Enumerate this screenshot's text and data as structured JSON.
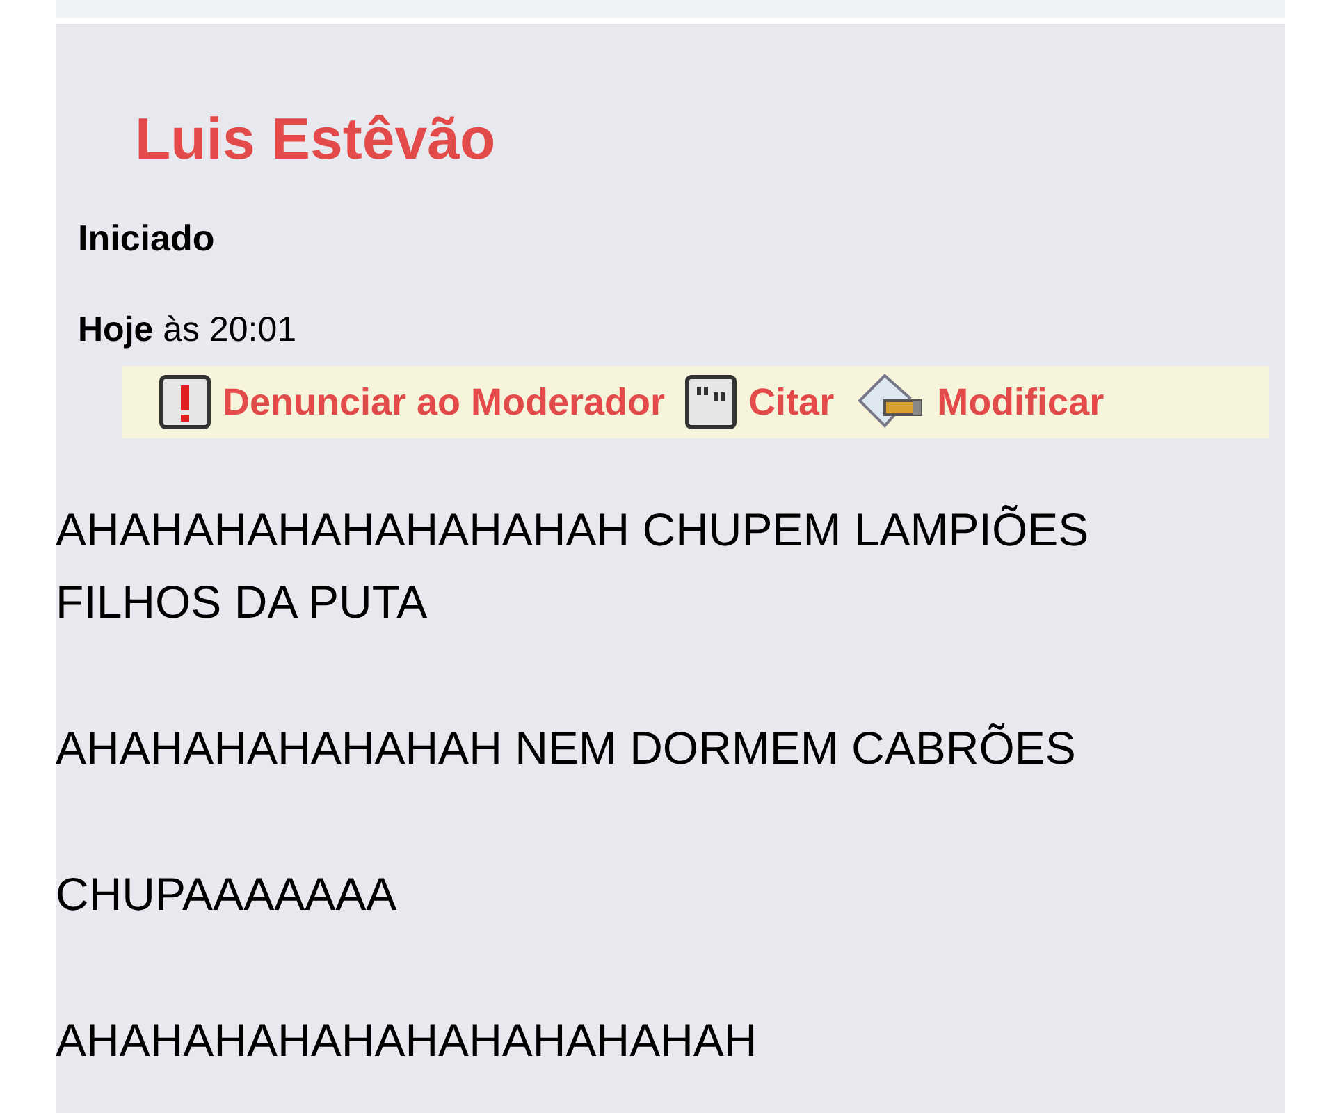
{
  "post": {
    "author": "Luis Estêvão",
    "label": "Iniciado",
    "date": "**Hoje** às 20:01",
    "actions": [
      {
        "kind": "report",
        "label": "Denunciar ao Moderador"
      },
      {
        "kind": "quote",
        "label": "Citar"
      },
      {
        "kind": "edit",
        "label": "Modificar"
      }
    ],
    "body": [
      "AHAHAHAHAHAHAHAHAH CHUPEM LAMPIÕES FILHOS DA PUTA",
      "AHAHAHAHAHAHAH NEM DORMEM CABRÕES",
      "CHUPAAAAAAA",
      "AHAHAHAHAHAHAHAHAHAHAH"
    ]
  }
}
